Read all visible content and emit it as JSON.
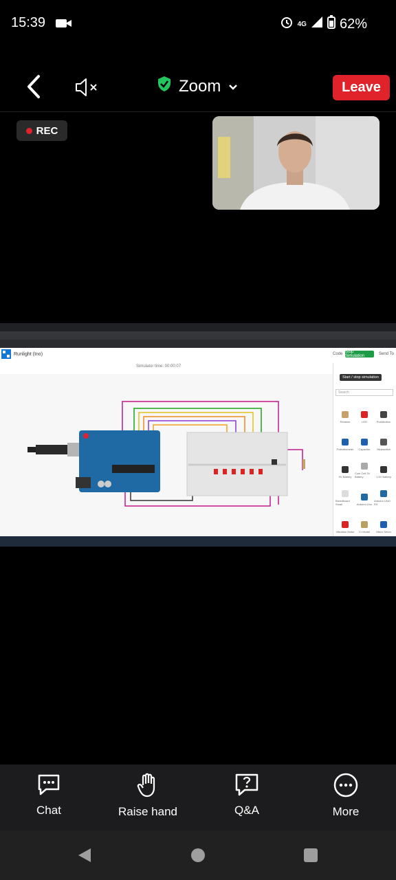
{
  "status_bar": {
    "time": "15:39",
    "network": "4G",
    "battery": "62%"
  },
  "meeting": {
    "title": "Zoom",
    "leave_label": "Leave",
    "rec_label": "REC"
  },
  "shared_screen": {
    "project_title": "Runlight (Ino)",
    "simulator_time": "Simulator time: 00:00:07",
    "code_label": "Code",
    "stop_label": "Stop Simulation",
    "send_label": "Send To",
    "tooltip": "Start / stop simulation",
    "search_placeholder": "Search",
    "components": [
      "Resistor",
      "LED",
      "Pushbutton",
      "Potentiometer",
      "Capacitor",
      "Slideswitch",
      "9V Battery",
      "Coin Cell 3V Battery",
      "1.5V Battery",
      "Breadboard Small",
      "Arduino Uno",
      "Arduino UNO R3",
      "Vibration Motor",
      "Cr Model",
      "Micro Servo",
      "",
      "",
      ""
    ]
  },
  "controls": [
    {
      "label": "Chat",
      "icon": "chat-icon"
    },
    {
      "label": "Raise hand",
      "icon": "hand-icon"
    },
    {
      "label": "Q&A",
      "icon": "qa-icon"
    },
    {
      "label": "More",
      "icon": "more-icon"
    }
  ],
  "colors": {
    "leave": "#e0232a",
    "shield": "#22c55e",
    "stop_sim": "#1e9b47"
  }
}
